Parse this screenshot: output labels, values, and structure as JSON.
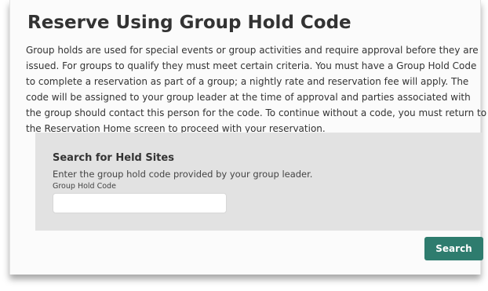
{
  "page": {
    "title": "Reserve Using Group Hold Code",
    "intro": "Group holds are used for special events or group activities and require approval before they are issued. For groups to qualify they must meet certain criteria. You must have a Group Hold Code to complete a reservation as part of a group; a nightly rate and reservation fee will apply. The code will be assigned to your group leader at the time of approval and parties associated with the group should contact this person for the code. To continue without a code, you must return to the Reservation Home screen to proceed with your reservation."
  },
  "search_panel": {
    "heading": "Search for Held Sites",
    "description": "Enter the group hold code provided by your group leader.",
    "field_label": "Group Hold Code",
    "field_value": "",
    "field_placeholder": ""
  },
  "actions": {
    "search_label": "Search"
  },
  "colors": {
    "accent": "#2e7c6e",
    "panel_background": "#e2e2e2",
    "text": "#333333"
  }
}
